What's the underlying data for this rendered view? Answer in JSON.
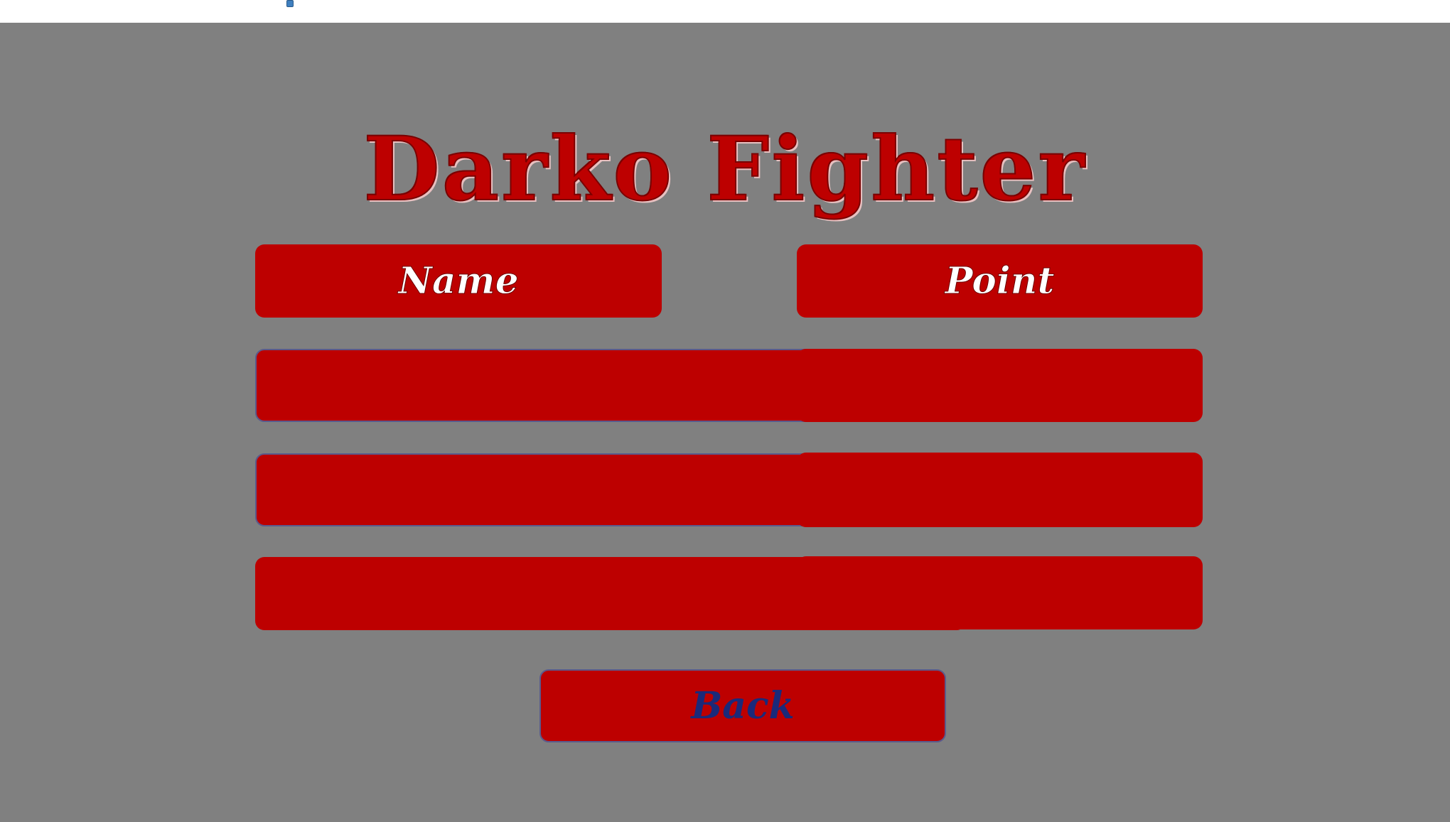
{
  "game": {
    "title": "Darko Fighter"
  },
  "scoreboard": {
    "headers": {
      "name": "Name",
      "point": "Point"
    },
    "rows": [
      {
        "name": "",
        "point": ""
      },
      {
        "name": "",
        "point": ""
      },
      {
        "name": "",
        "point": ""
      }
    ]
  },
  "controls": {
    "back_label": "Back"
  },
  "colors": {
    "background": "#808080",
    "panel": "#bd0000",
    "title": "#bd0000",
    "header_text": "#ffffff",
    "back_text": "#1a2a7a"
  }
}
